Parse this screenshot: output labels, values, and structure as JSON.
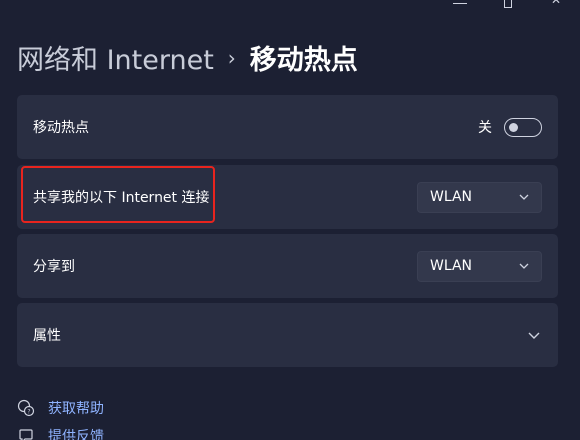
{
  "header": {
    "parent": "网络和 Internet",
    "separator": "›",
    "current": "移动热点"
  },
  "hotspot": {
    "label": "移动热点",
    "state_text": "关",
    "enabled": false
  },
  "share_from": {
    "label": "共享我的以下 Internet 连接",
    "value": "WLAN"
  },
  "share_over": {
    "label": "分享到",
    "value": "WLAN"
  },
  "properties": {
    "label": "属性"
  },
  "links": [
    {
      "label": "获取帮助",
      "icon": "help-icon"
    },
    {
      "label": "提供反馈",
      "icon": "feedback-icon"
    }
  ],
  "window_controls": [
    "minimize-icon",
    "maximize-icon",
    "close-icon"
  ],
  "colors": {
    "background": "#1c2033",
    "card": "#292e42",
    "link": "#8fb3ff",
    "highlight": "#e8241e"
  }
}
